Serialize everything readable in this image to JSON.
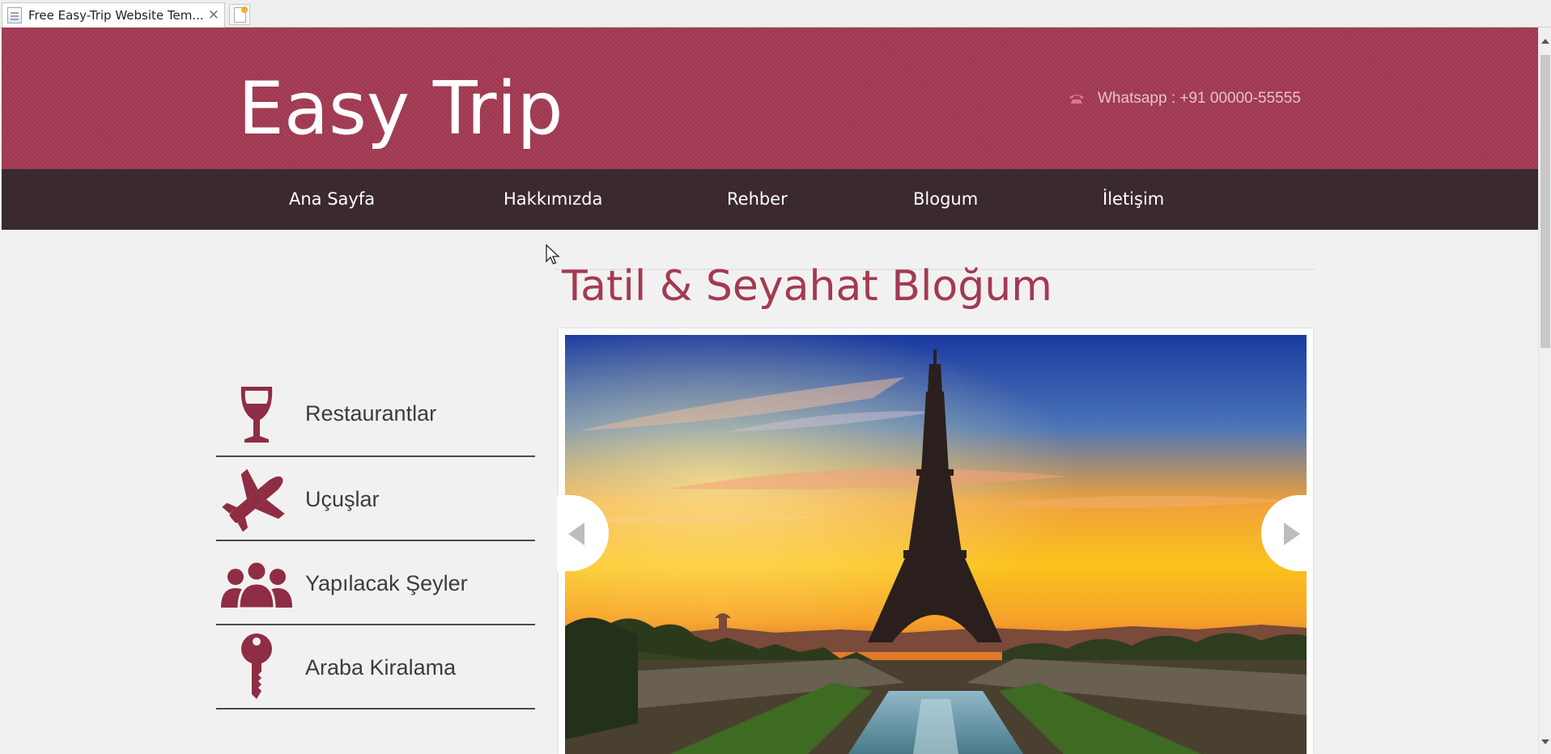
{
  "browser": {
    "tab_title": "Free Easy-Trip Website Tem...",
    "tab_close": "✕"
  },
  "header": {
    "logo": "Easy Trip",
    "contact_text": "Whatsapp : +91 00000-55555",
    "contact_icon": "phone-icon"
  },
  "nav": {
    "items": [
      {
        "label": "Ana Sayfa"
      },
      {
        "label": "Hakkımızda"
      },
      {
        "label": "Rehber"
      },
      {
        "label": "Blogum"
      },
      {
        "label": "İletişim"
      }
    ]
  },
  "sidebar": {
    "items": [
      {
        "label": "Restaurantlar",
        "icon": "wine-glass-icon"
      },
      {
        "label": "Uçuşlar",
        "icon": "airplane-icon"
      },
      {
        "label": "Yapılacak Şeyler",
        "icon": "people-icon"
      },
      {
        "label": "Araba Kiralama",
        "icon": "key-icon"
      }
    ]
  },
  "main": {
    "blog_title": "Tatil & Seyahat Bloğum"
  },
  "colors": {
    "brand": "#a33a52",
    "nav_bg": "#3a2a2d",
    "page_bg": "#f2f1f1",
    "icon": "#8e2d44"
  }
}
